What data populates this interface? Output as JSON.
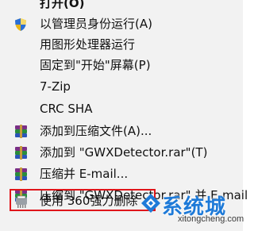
{
  "context_menu": {
    "items": [
      {
        "label": "打开(O)",
        "icon": "none"
      },
      {
        "label": "以管理员身份运行(A)",
        "icon": "uac-shield-icon"
      },
      {
        "label": "用图形处理器运行",
        "icon": "none"
      },
      {
        "label": "固定到\"开始\"屏幕(P)",
        "icon": "none"
      },
      {
        "label": "7-Zip",
        "icon": "none"
      },
      {
        "label": "CRC SHA",
        "icon": "none"
      },
      {
        "label": "添加到压缩文件(A)...",
        "icon": "winrar-icon"
      },
      {
        "label": "添加到 \"GWXDetector.rar\"(T)",
        "icon": "winrar-icon"
      },
      {
        "label": "压缩并 E-mail...",
        "icon": "winrar-icon"
      },
      {
        "label": "压缩到 \"GWXDetector.rar\" 并 E-mail",
        "icon": "winrar-icon"
      },
      {
        "label": "使用 360强力删除",
        "icon": "360-shredder-icon"
      }
    ],
    "highlighted_item_index": 10
  },
  "watermark": {
    "title": "系统城",
    "url": "xitongcheng.com"
  },
  "colors": {
    "menu_background": "#f2f2f2",
    "highlight_border": "#e0161b",
    "watermark_blue": "#1e7ad8"
  }
}
